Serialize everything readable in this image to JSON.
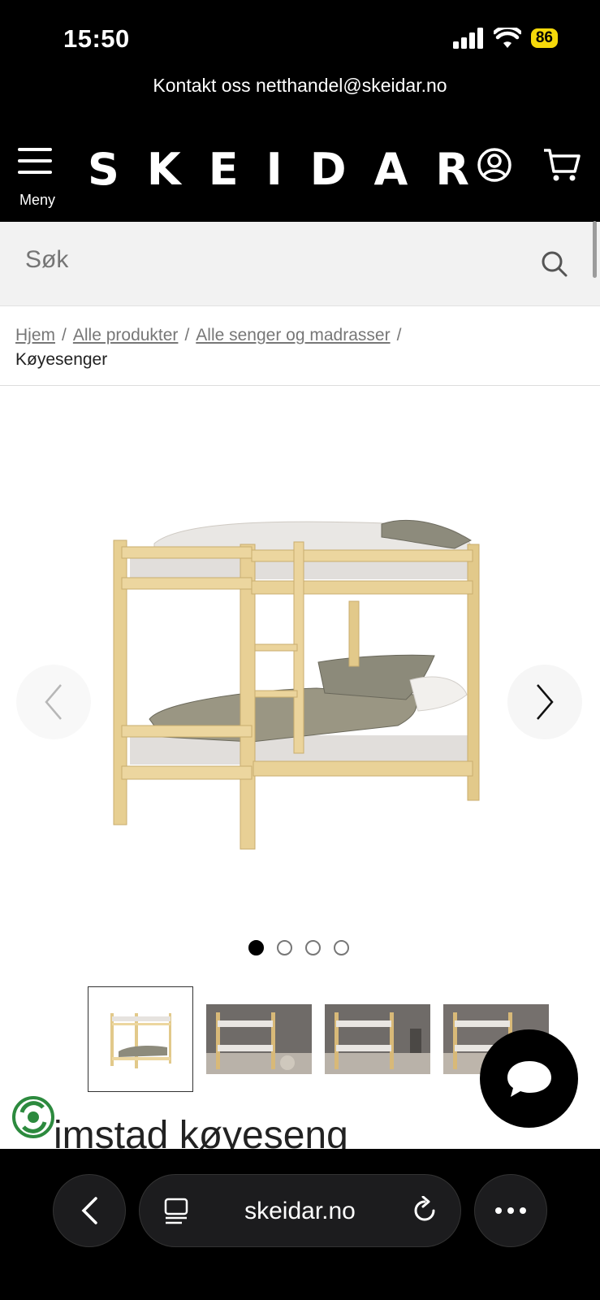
{
  "status": {
    "time": "15:50",
    "battery": "86"
  },
  "contact": {
    "text": "Kontakt oss netthandel@skeidar.no"
  },
  "header": {
    "menu_label": "Meny",
    "logo": "SKEIDAR"
  },
  "search": {
    "placeholder": "Søk"
  },
  "breadcrumb": {
    "items": [
      "Hjem",
      "Alle produkter",
      "Alle senger og madrasser"
    ],
    "current": "Køyesenger"
  },
  "gallery": {
    "slide_count": 4,
    "active_slide": 1
  },
  "product": {
    "title": "imstad køyeseng"
  },
  "browser": {
    "url": "skeidar.no"
  },
  "colors": {
    "background": "#000000",
    "battery": "#f5d90a",
    "search_bg": "#f2f2f2"
  }
}
